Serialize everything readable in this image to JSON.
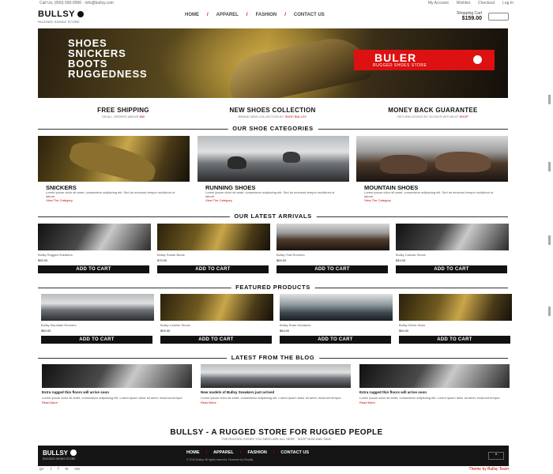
{
  "topbar": {
    "left": "Call Us: (000) 000-0000 · info@bullsy.com",
    "right": [
      "My Account",
      "Wishlist",
      "Checkout",
      "Log In"
    ]
  },
  "header": {
    "logo": "BULLSY",
    "logo_tag": "RUGGED SHOES STORE",
    "nav": [
      "HOME",
      "APPAREL",
      "FASHION",
      "CONTACT US"
    ],
    "cart_label": "Shopping Cart",
    "cart_total": "$159.00"
  },
  "hero": {
    "words": [
      "SHOES",
      "SNICKERS",
      "BOOTS",
      "RUGGEDNESS"
    ],
    "badge_title": "BULER",
    "badge_sub": "RUGGED SHOES STORE"
  },
  "features": [
    {
      "title": "FREE SHIPPING",
      "sub_pre": "ON ALL ORDERS ABOVE ",
      "sub_hl": "$50"
    },
    {
      "title": "NEW SHOES COLLECTION",
      "sub_pre": "BRAND NEW COLLECTION BY ",
      "sub_hl": "SHOP BULLSY"
    },
    {
      "title": "MONEY BACK GUARANTEE",
      "sub_pre": "RETURN GOODS BY 30 DAYS WITHIN AT ",
      "sub_hl": "SHOP"
    }
  ],
  "sections": {
    "categories": "OUR SHOE CATEGORIES",
    "arrivals": "OUR LATEST ARRIVALS",
    "featured": "FEATURED PRODUCTS",
    "blog": "LATEST FROM THE BLOG"
  },
  "categories": [
    {
      "name": "SNICKERS",
      "desc": "Lorem ipsum dolor sit amet, consectetur adipiscing elit. Sed do eiusmod tempor incididunt ut labore.",
      "link": "View The Category"
    },
    {
      "name": "RUNNING SHOES",
      "desc": "Lorem ipsum dolor sit amet, consectetur adipiscing elit. Sed do eiusmod tempor incididunt ut labore.",
      "link": "View The Category"
    },
    {
      "name": "MOUNTAIN SHOES",
      "desc": "Lorem ipsum dolor sit amet, consectetur adipiscing elit. Sed do eiusmod tempor incididunt ut labore.",
      "link": "View The Category"
    }
  ],
  "arrivals": [
    {
      "name": "Bullsy Rugged Sneakers",
      "price": "$59.00",
      "button": "ADD TO CART"
    },
    {
      "name": "Bullsy Suede Boots",
      "price": "$79.00",
      "button": "ADD TO CART"
    },
    {
      "name": "Bullsy Trail Runners",
      "price": "$69.00",
      "button": "ADD TO CART"
    },
    {
      "name": "Bullsy Canvas Shoes",
      "price": "$49.00",
      "button": "ADD TO CART"
    }
  ],
  "featured": [
    {
      "name": "Bullsy Mountain Runners",
      "price": "$89.00",
      "button": "ADD TO CART"
    },
    {
      "name": "Bullsy Leather Shoes",
      "price": "$99.00",
      "button": "ADD TO CART"
    },
    {
      "name": "Bullsy Road Sneakers",
      "price": "$64.00",
      "button": "ADD TO CART"
    },
    {
      "name": "Bullsy Street Kicks",
      "price": "$54.00",
      "button": "ADD TO CART"
    }
  ],
  "blog": [
    {
      "title": "Extra rugged thin floors will arrive soon",
      "desc": "Lorem ipsum dolor sit amet, consectetur adipiscing elit. Lorem ipsum dolor sit amet, eiusmod tempor.",
      "more": "Read More"
    },
    {
      "title": "New models of Bullsy Sneakers just arrived",
      "desc": "Lorem ipsum dolor sit amet, consectetur adipiscing elit. Lorem ipsum dolor sit amet, eiusmod tempor.",
      "more": "Read More"
    },
    {
      "title": "Extra rugged thin floors will arrive soon",
      "desc": "Lorem ipsum dolor sit amet, consectetur adipiscing elit. Lorem ipsum dolor sit amet, eiusmod tempor.",
      "more": "Read More"
    }
  ],
  "footer": {
    "tagline": "BULLSY - A RUGGED STORE FOR RUGGED PEOPLE",
    "tagline_sub": "THE RUGGED SHOES YOU NEED ARE ALL HERE · SHOP NOW AND SAVE",
    "logo": "BULLSY",
    "logo_tag": "RUGGED SHOES STORE",
    "nav": [
      "HOME",
      "APPAREL",
      "FASHION",
      "CONTACT US"
    ],
    "copyright": "© 2014 Bullsy. All rights reserved. Powered by Shopify.",
    "to_top": "^",
    "social": [
      "g+",
      "t",
      "f",
      "in",
      "rss"
    ],
    "credit": "Theme by Bullsy Team"
  },
  "colors": {
    "accent": "#cc0000",
    "dark": "#141414"
  }
}
